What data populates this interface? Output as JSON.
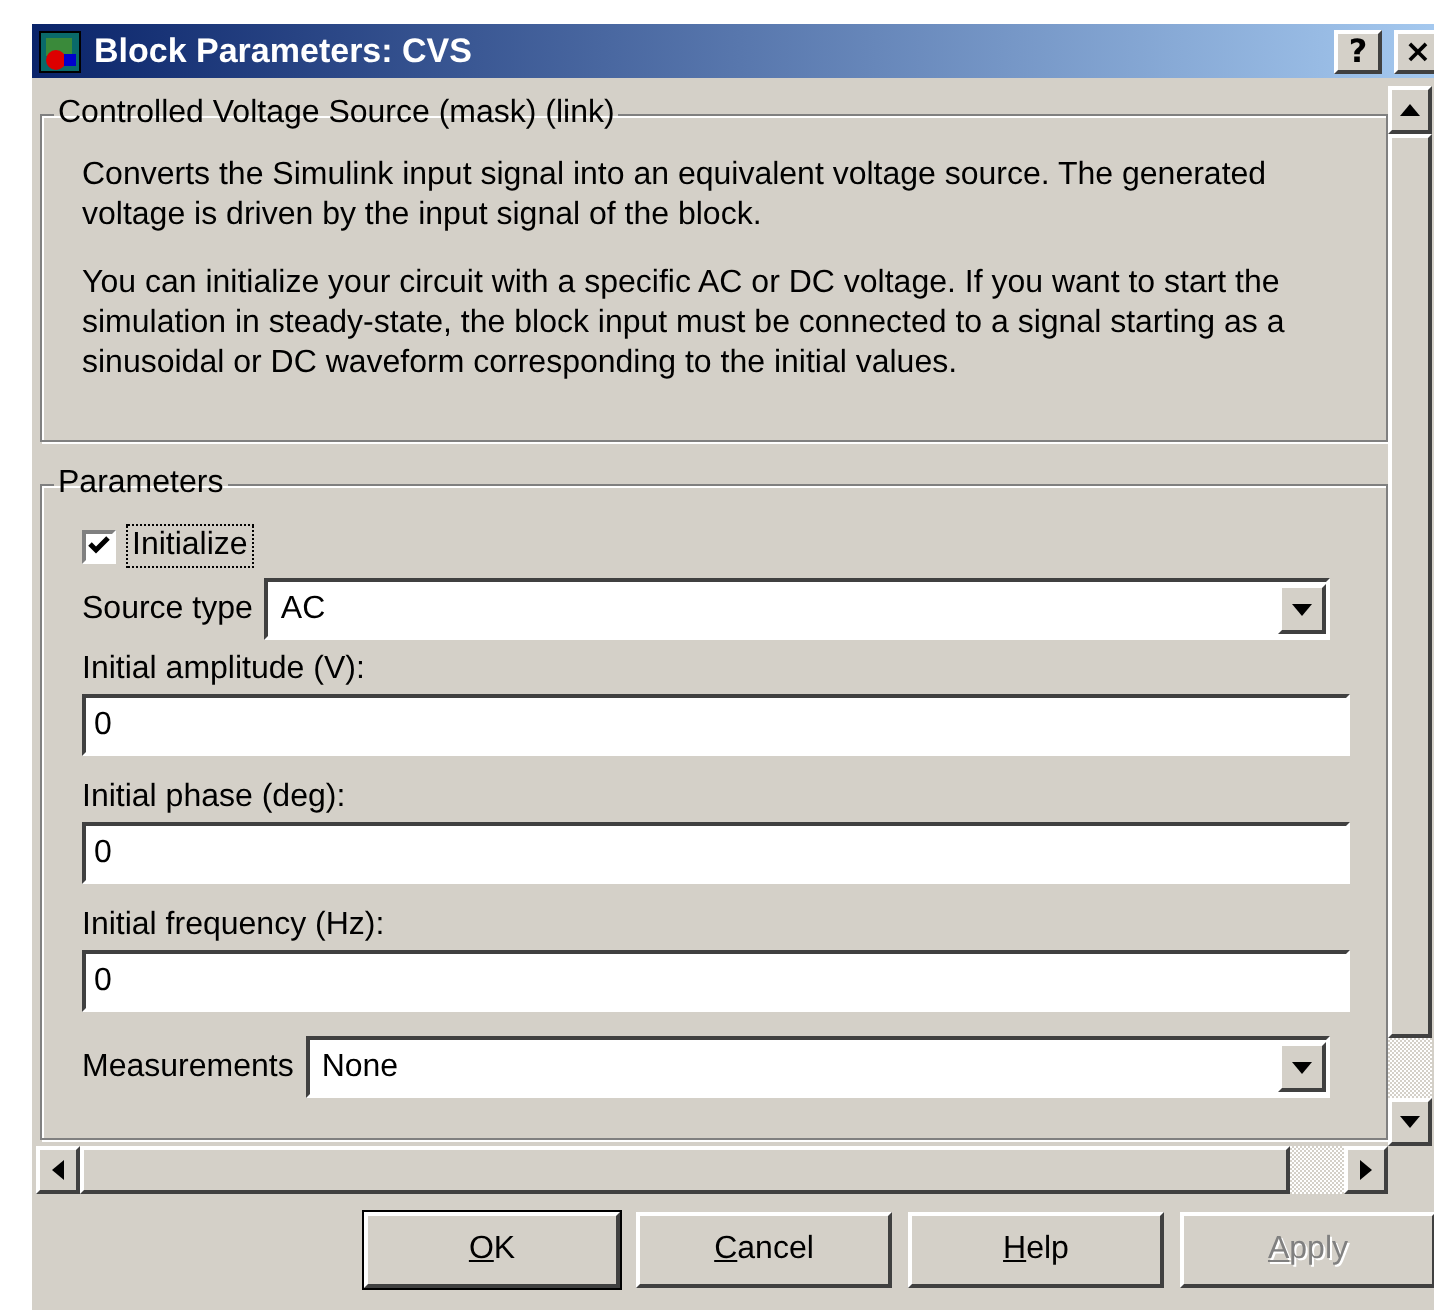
{
  "window": {
    "title": "Block Parameters: CVS",
    "help_button": "?",
    "close_button": "×"
  },
  "description": {
    "title": "Controlled Voltage Source (mask) (link)",
    "paragraphs": [
      "Converts the Simulink input signal into an equivalent voltage source. The generated voltage is driven by the input signal of the block.",
      "You can initialize your circuit with a specific AC or DC voltage. If you want to start the simulation in steady-state, the block input must be connected to a signal starting as a sinusoidal or DC waveform corresponding to the initial values."
    ]
  },
  "parameters": {
    "title": "Parameters",
    "items": [
      {
        "kind": "checkbox",
        "label": "Initialize",
        "checked": true
      },
      {
        "kind": "dropdown",
        "label": "Source type",
        "value": "AC"
      },
      {
        "kind": "field",
        "label": "Initial amplitude (V):",
        "value": "0"
      },
      {
        "kind": "field",
        "label": "Initial phase (deg):",
        "value": "0"
      },
      {
        "kind": "field",
        "label": "Initial frequency (Hz):",
        "value": "0"
      },
      {
        "kind": "dropdown",
        "label": "Measurements",
        "value": "None"
      }
    ]
  },
  "buttons": [
    {
      "label": "OK",
      "default": true,
      "disabled": false
    },
    {
      "label": "Cancel",
      "default": false,
      "disabled": false
    },
    {
      "label": "Help",
      "default": false,
      "disabled": false
    },
    {
      "label": "Apply",
      "default": false,
      "disabled": true
    }
  ]
}
